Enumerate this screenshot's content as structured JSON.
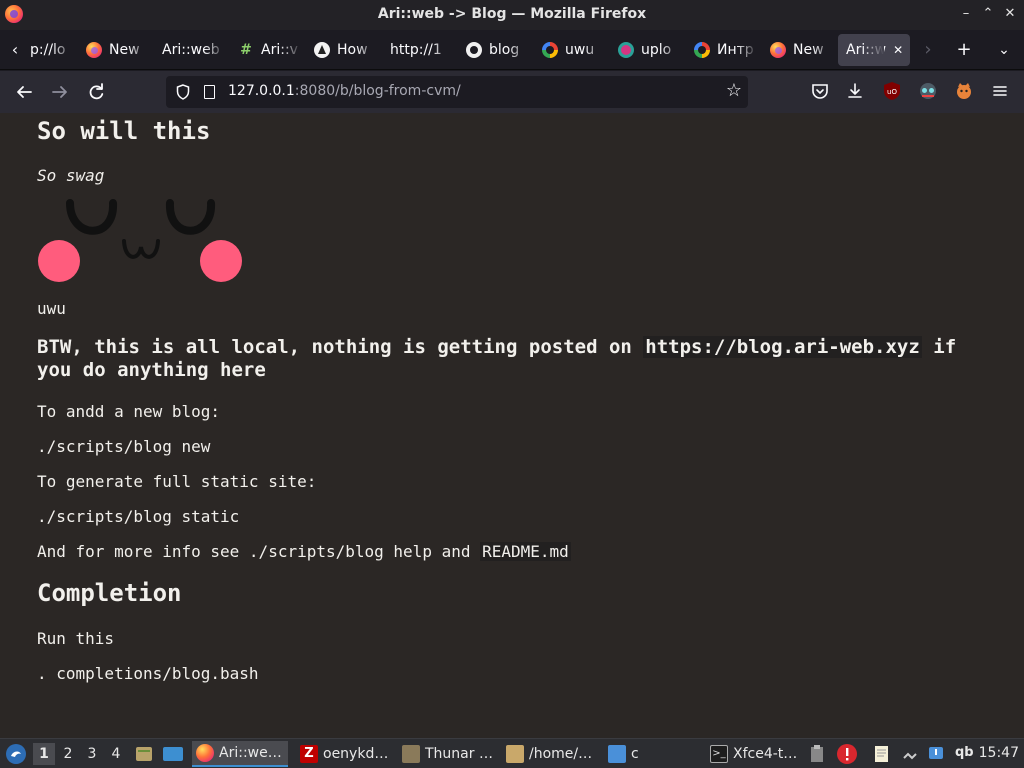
{
  "window": {
    "title": "Ari::web -> Blog — Mozilla Firefox",
    "controls": {
      "minimize": "–",
      "maximize": "⌃",
      "close": "✕"
    }
  },
  "tabs": [
    {
      "label": "p://lo",
      "favicon": "none"
    },
    {
      "label": "New",
      "favicon": "firefox-icon"
    },
    {
      "label": "Ari::web",
      "favicon": "none"
    },
    {
      "label": "Ari::v",
      "favicon": "hash-icon"
    },
    {
      "label": "How",
      "favicon": "arch-icon"
    },
    {
      "label": "http://1",
      "favicon": "none"
    },
    {
      "label": "blog",
      "favicon": "github-icon"
    },
    {
      "label": "uwu",
      "favicon": "google-icon"
    },
    {
      "label": "uplo",
      "favicon": "upload-icon"
    },
    {
      "label": "Интр",
      "favicon": "google-icon"
    },
    {
      "label": "New",
      "favicon": "firefox-icon"
    },
    {
      "label": "Ari::w",
      "favicon": "none",
      "active": true
    }
  ],
  "navbar": {
    "url_host": "127.0.0.1",
    "url_rest": ":8080/b/blog-from-cvm/"
  },
  "article": {
    "heading_so_will": "So will this",
    "swag": "So swag",
    "uwu_caption": "uwu",
    "btw_prefix": "BTW, this is all local, nothing is getting posted on ",
    "btw_link": "https://blog.ari-web.xyz",
    "btw_suffix": " if you do anything here",
    "add_blog_label": "To andd a new blog:",
    "add_blog_cmd": "./scripts/blog new",
    "static_label": "To generate full static site:",
    "static_cmd": "./scripts/blog static",
    "more_info_prefix": "And for more info see ./scripts/blog help and ",
    "more_info_code": "README.md",
    "completion_heading": "Completion",
    "run_this": "Run this",
    "completion_cmd": ". completions/blog.bash"
  },
  "taskbar": {
    "workspaces": [
      "1",
      "2",
      "3",
      "4"
    ],
    "items": [
      {
        "label": "Ari::we…",
        "icon": "firefox-icon",
        "active": true
      },
      {
        "label": "oenykd…",
        "icon": "filezilla-icon"
      },
      {
        "label": "Thunar …",
        "icon": "thunar-icon"
      },
      {
        "label": "/home/…",
        "icon": "archive-icon"
      },
      {
        "label": "c",
        "icon": "folder-icon"
      },
      {
        "label": "Xfce4-t…",
        "icon": "terminal-icon"
      }
    ],
    "tray_qb": "qb",
    "clock": "15:47"
  }
}
